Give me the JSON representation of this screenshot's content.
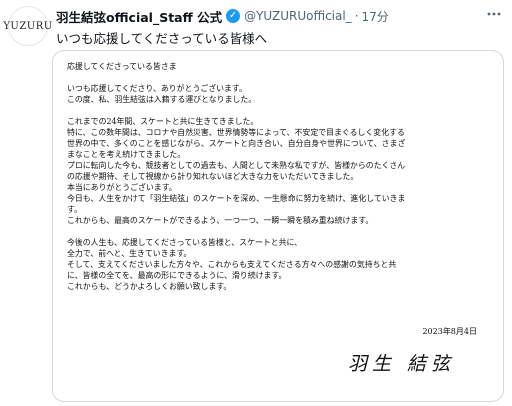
{
  "post": {
    "avatar_text": "YUZURU",
    "author_name": "羽生結弦official_Staff 公式",
    "verified_mark": "✓",
    "handle": "@YUZURUofficial_",
    "separator": "·",
    "time": "17分",
    "more_icon": "more-icon",
    "text": "いつも応援してくださっている皆様へ"
  },
  "letter": {
    "lines": [
      "応援してくださっている皆さま",
      "",
      "いつも応援してくださり、ありがとうございます。",
      "この度、私、羽生結弦は入籍する運びとなりました。",
      "",
      "これまでの24年間、スケートと共に生きてきました。",
      "特に、この数年間は、コロナや自然災害、世界情勢等によって、不安定で目まぐるしく変化する",
      "世界の中で、多くのことを感じながら、スケートと向き合い、自分自身や世界について、さまざ",
      "まなことを考え続けてきました。",
      "プロに転向した今も、競技者としての過去も、人間として未熟な私ですが、皆様からのたくさん",
      "の応援や期待、そして視線から計り知れないほど大きな力をいただいてきました。",
      "本当にありがとうございます。",
      "今日も、人生をかけて「羽生結弦」のスケートを深め、一生懸命に努力を続け、進化していきま",
      "す。",
      "これからも、最高のスケートができるよう、一つ一つ、一瞬一瞬を積み重ね続けます。",
      "",
      "今後の人生も、応援してくださっている皆様と、スケートと共に、",
      "全力で、前へと、生きていきます。",
      "そして、支えてくださいました方々や、これからも支えてくださる方々への感謝の気持ちと共",
      "に、皆様の全てを、最高の形にできるように、滑り続けます。",
      "これからも、どうかよろしくお願い致します。"
    ],
    "date": "2023年8月4日",
    "signature": "羽生 結弦"
  }
}
